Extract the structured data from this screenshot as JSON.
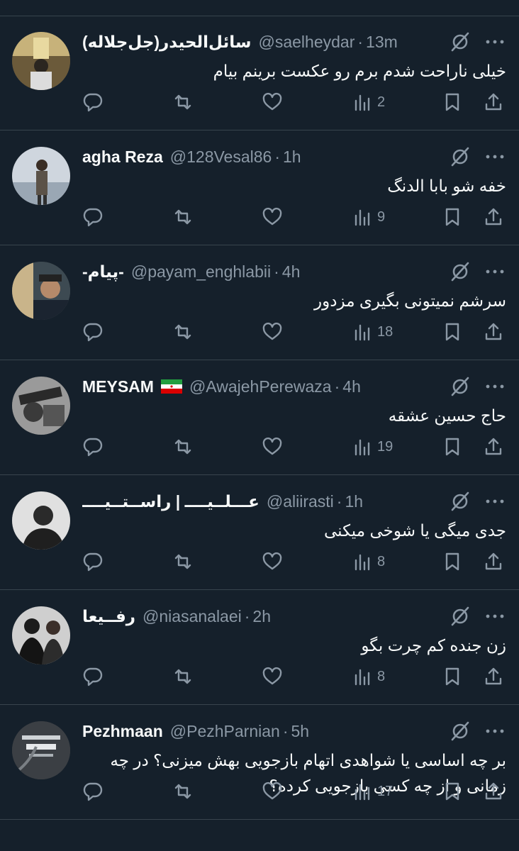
{
  "colors": {
    "background": "#15202b",
    "text": "#f7f9f9",
    "muted": "#8b98a5",
    "divider": "#38444d"
  },
  "replies": [
    {
      "name": "سائل‌الحیدر(جل‌جلاله)",
      "name_rtl": true,
      "handle": "@saelheydar",
      "time": "13m",
      "text": "خیلی ناراحت شدم برم رو عکست برینم بیام",
      "views": "2",
      "avatar_icon": "shrine-photo"
    },
    {
      "name": "agha Reza",
      "name_rtl": false,
      "handle": "@128Vesal86",
      "time": "1h",
      "text": "خفه شو بابا الدنگ",
      "views": "9",
      "avatar_icon": "person-photo"
    },
    {
      "name": "-پیام-",
      "name_rtl": true,
      "handle": "@payam_enghlabii",
      "time": "4h",
      "text": "سرشم نمیتونی بگیری مزدور",
      "views": "18",
      "avatar_icon": "selfie-photo"
    },
    {
      "name": "MEYSAM",
      "name_rtl": false,
      "flag": "iran-flag",
      "handle": "@AwajehPerewaza",
      "time": "4h",
      "text": "حاج حسین عشقه",
      "views": "19",
      "avatar_icon": "bw-photo"
    },
    {
      "name": "عـــلــیــــ | راســتــیــــ",
      "name_rtl": true,
      "handle": "@aliirasti",
      "time": "1h",
      "text": "جدی میگی یا شوخی میکنی",
      "views": "8",
      "avatar_icon": "bw-portrait"
    },
    {
      "name": "رفــیعا",
      "name_rtl": true,
      "handle": "@niasanalaei",
      "time": "2h",
      "text": "زن جنده کم چرت بگو",
      "views": "8",
      "avatar_icon": "group-photo"
    },
    {
      "name": "Pezhmaan",
      "name_rtl": false,
      "handle": "@PezhParnian",
      "time": "5h",
      "text": "بر چه اساسی یا شواهدی اتهام بازجویی بهش میزنی؟ در چه زمانی و از چه کسی بازجویی کرده؟",
      "views": "17",
      "avatar_icon": "text-poster"
    }
  ]
}
